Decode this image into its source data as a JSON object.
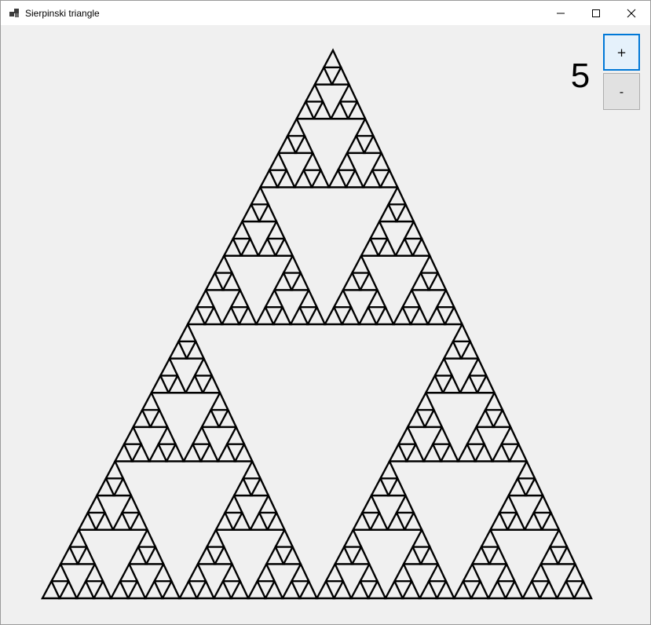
{
  "window": {
    "title": "Sierpinski triangle"
  },
  "titlebar_icons": {
    "app": "app-icon",
    "minimize": "minimize-icon",
    "maximize": "maximize-icon",
    "close": "close-icon"
  },
  "controls": {
    "level_value": "5",
    "increase_label": "+",
    "decrease_label": "-"
  },
  "fractal": {
    "type": "sierpinski-triangle",
    "depth": 5,
    "stroke_color": "#000000"
  },
  "colors": {
    "background": "#f0f0f0",
    "titlebar": "#ffffff",
    "button_face": "#e1e1e1",
    "focus_border": "#0078d7"
  }
}
